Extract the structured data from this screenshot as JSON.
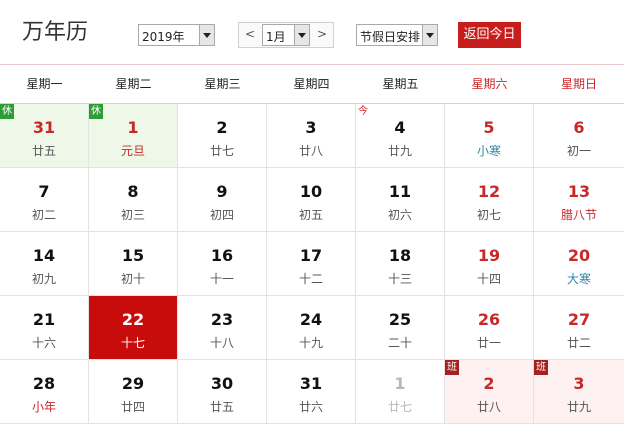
{
  "header": {
    "title": "万年历",
    "year_value": "2019年",
    "month_prev": "<",
    "month_value": "1月",
    "month_next": ">",
    "holiday_value": "节假日安排",
    "today_button": "返回今日"
  },
  "weekdays": [
    "星期一",
    "星期二",
    "星期三",
    "星期四",
    "星期五",
    "星期六",
    "星期日"
  ],
  "colors": {
    "accent": "#c81d1d",
    "rest_badge": "#2f9d36",
    "work_badge": "#a52020",
    "holiday_bg": "#eef8e8",
    "solar_term": "#2f87a8"
  },
  "cells": [
    {
      "day": "31",
      "lunar": "廿五",
      "badge": "休",
      "type": "holiday"
    },
    {
      "day": "1",
      "lunar": "元旦",
      "badge": "休",
      "type": "holiday",
      "lunar_style": "festival"
    },
    {
      "day": "2",
      "lunar": "廿七"
    },
    {
      "day": "3",
      "lunar": "廿八"
    },
    {
      "day": "4",
      "lunar": "廿九",
      "badge": "今",
      "badge_type": "today-mark"
    },
    {
      "day": "5",
      "lunar": "小寒",
      "weekend": true,
      "lunar_style": "solarterm"
    },
    {
      "day": "6",
      "lunar": "初一",
      "weekend": true
    },
    {
      "day": "7",
      "lunar": "初二"
    },
    {
      "day": "8",
      "lunar": "初三"
    },
    {
      "day": "9",
      "lunar": "初四"
    },
    {
      "day": "10",
      "lunar": "初五"
    },
    {
      "day": "11",
      "lunar": "初六"
    },
    {
      "day": "12",
      "lunar": "初七",
      "weekend": true
    },
    {
      "day": "13",
      "lunar": "腊八节",
      "weekend": true,
      "lunar_style": "festival"
    },
    {
      "day": "14",
      "lunar": "初九"
    },
    {
      "day": "15",
      "lunar": "初十"
    },
    {
      "day": "16",
      "lunar": "十一"
    },
    {
      "day": "17",
      "lunar": "十二"
    },
    {
      "day": "18",
      "lunar": "十三"
    },
    {
      "day": "19",
      "lunar": "十四",
      "weekend": true
    },
    {
      "day": "20",
      "lunar": "大寒",
      "weekend": true,
      "lunar_style": "solarterm"
    },
    {
      "day": "21",
      "lunar": "十六"
    },
    {
      "day": "22",
      "lunar": "十七",
      "type": "today"
    },
    {
      "day": "23",
      "lunar": "十八"
    },
    {
      "day": "24",
      "lunar": "十九"
    },
    {
      "day": "25",
      "lunar": "二十"
    },
    {
      "day": "26",
      "lunar": "廿一",
      "weekend": true
    },
    {
      "day": "27",
      "lunar": "廿二",
      "weekend": true
    },
    {
      "day": "28",
      "lunar": "小年",
      "lunar_style": "festival"
    },
    {
      "day": "29",
      "lunar": "廿四"
    },
    {
      "day": "30",
      "lunar": "廿五"
    },
    {
      "day": "31",
      "lunar": "廿六"
    },
    {
      "day": "1",
      "lunar": "廿七",
      "type": "other"
    },
    {
      "day": "2",
      "lunar": "廿八",
      "badge": "班",
      "type": "workday"
    },
    {
      "day": "3",
      "lunar": "廿九",
      "badge": "班",
      "type": "workday"
    }
  ]
}
